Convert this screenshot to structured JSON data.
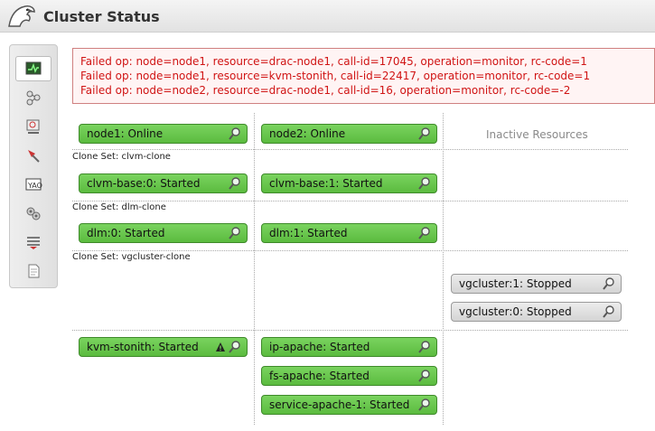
{
  "header": {
    "title": "Cluster Status"
  },
  "toolbar": {
    "items": [
      {
        "icon": "cluster-status-icon",
        "active": true
      },
      {
        "icon": "graph-icon"
      },
      {
        "icon": "nodes-icon"
      },
      {
        "icon": "resources-icon"
      },
      {
        "icon": "constraints-icon"
      },
      {
        "icon": "configuration-icon"
      },
      {
        "icon": "history-icon"
      },
      {
        "icon": "document-icon"
      }
    ]
  },
  "errors": [
    "Failed op: node=node1, resource=drac-node1, call-id=17045, operation=monitor, rc-code=1",
    "Failed op: node=node1, resource=kvm-stonith, call-id=22417, operation=monitor, rc-code=1",
    "Failed op: node=node2, resource=drac-node1, call-id=16, operation=monitor, rc-code=-2"
  ],
  "nodes": {
    "node1": "node1: Online",
    "node2": "node2: Online",
    "inactive": "Inactive Resources"
  },
  "clone_sets": {
    "clvm": {
      "label": "Clone Set: clvm-clone",
      "col1": "clvm-base:0: Started",
      "col2": "clvm-base:1: Started"
    },
    "dlm": {
      "label": "Clone Set: dlm-clone",
      "col1": "dlm:0: Started",
      "col2": "dlm:1: Started"
    },
    "vgcluster": {
      "label": "Clone Set: vgcluster-clone",
      "inactive1": "vgcluster:1: Stopped",
      "inactive2": "vgcluster:0: Stopped"
    }
  },
  "resources": {
    "kvm_stonith": "kvm-stonith: Started",
    "ip_apache": "ip-apache: Started",
    "fs_apache": "fs-apache: Started",
    "service_apache": "service-apache-1: Started"
  },
  "colors": {
    "started": "#5bbb3f",
    "stopped": "#d4d4d4",
    "error_text": "#d01414"
  }
}
